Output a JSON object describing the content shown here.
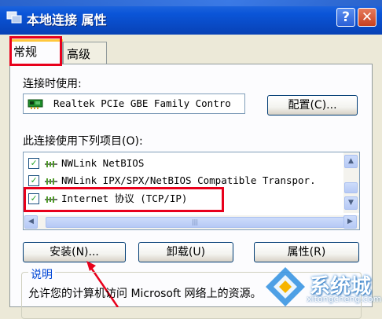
{
  "window": {
    "title": "本地连接 属性",
    "help_button": "?",
    "close_button": "✕"
  },
  "tabs": [
    {
      "label": "常规",
      "active": true
    },
    {
      "label": "高级",
      "active": false
    }
  ],
  "connect_using": {
    "label": "连接时使用:",
    "adapter": "Realtek PCIe GBE Family Contro",
    "configure_button": "配置(C)..."
  },
  "components": {
    "label": "此连接使用下列项目(O):",
    "items": [
      {
        "checked": true,
        "label": "NWLink NetBIOS"
      },
      {
        "checked": true,
        "label": "NWLink IPX/SPX/NetBIOS Compatible Transpor."
      },
      {
        "checked": true,
        "label": "Internet 协议 (TCP/IP)"
      }
    ],
    "hscroll_grip": "|||"
  },
  "buttons": {
    "install": "安装(N)...",
    "uninstall": "卸载(U)",
    "properties": "属性(R)"
  },
  "description": {
    "legend": "说明",
    "text": "允许您的计算机访问 Microsoft 网络上的资源。"
  },
  "watermark": {
    "brand": "系统城",
    "url": "xitongcheng.com"
  },
  "colors": {
    "highlight_red": "#e8001b",
    "titlebar_blue": "#0a55d8",
    "legend_blue": "#0046d5"
  }
}
